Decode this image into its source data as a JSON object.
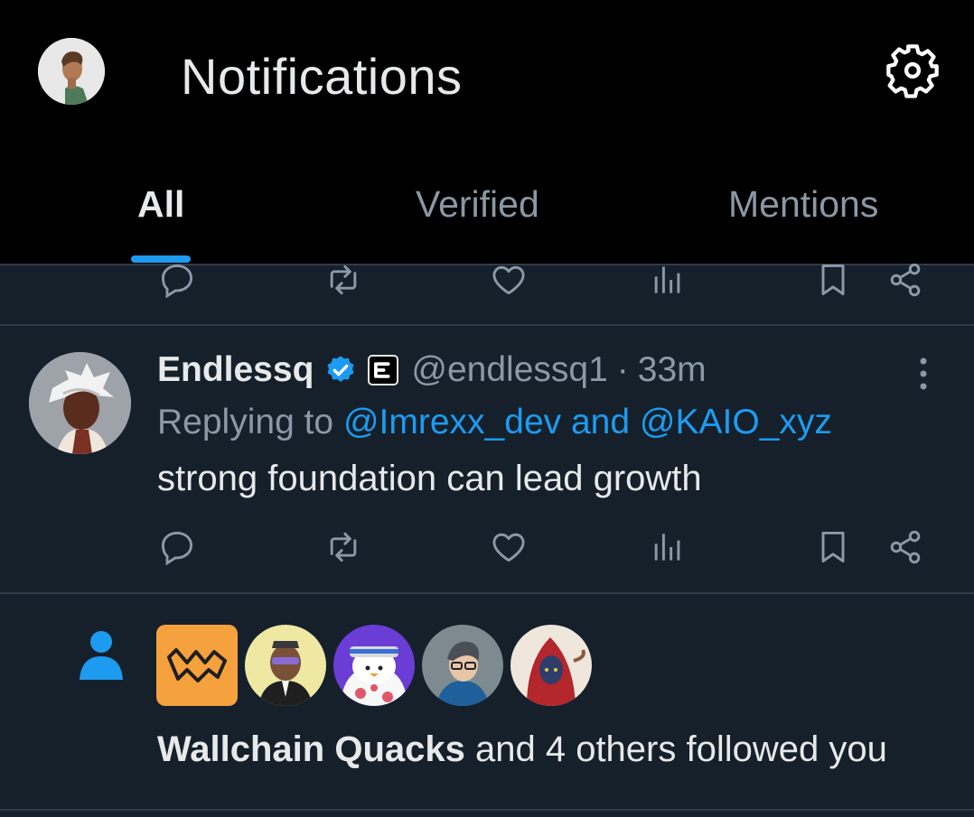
{
  "header": {
    "title": "Notifications",
    "avatar_icon": "user-avatar",
    "settings_icon": "gear-icon"
  },
  "tabs": [
    {
      "label": "All",
      "active": true
    },
    {
      "label": "Verified",
      "active": false
    },
    {
      "label": "Mentions",
      "active": false
    }
  ],
  "colors": {
    "accent": "#1d9bf0",
    "background": "#15202b",
    "header_bg": "#000000",
    "muted_text": "#8b98a5"
  },
  "post": {
    "author": "Endlessq",
    "handle": "@endlessq1",
    "separator": "·",
    "time": "33m",
    "replying_prefix": "Replying to",
    "mention_1": "@Imrexx_dev",
    "mention_joiner": "and",
    "mention_2": "@KAIO_xyz",
    "text": "strong foundation can lead growth"
  },
  "follow_notification": {
    "name": "Wallchain Quacks",
    "rest": "and 4 others followed you",
    "avatars": [
      "wallchain-logo",
      "avatar-2",
      "avatar-3",
      "avatar-4",
      "avatar-5"
    ]
  }
}
